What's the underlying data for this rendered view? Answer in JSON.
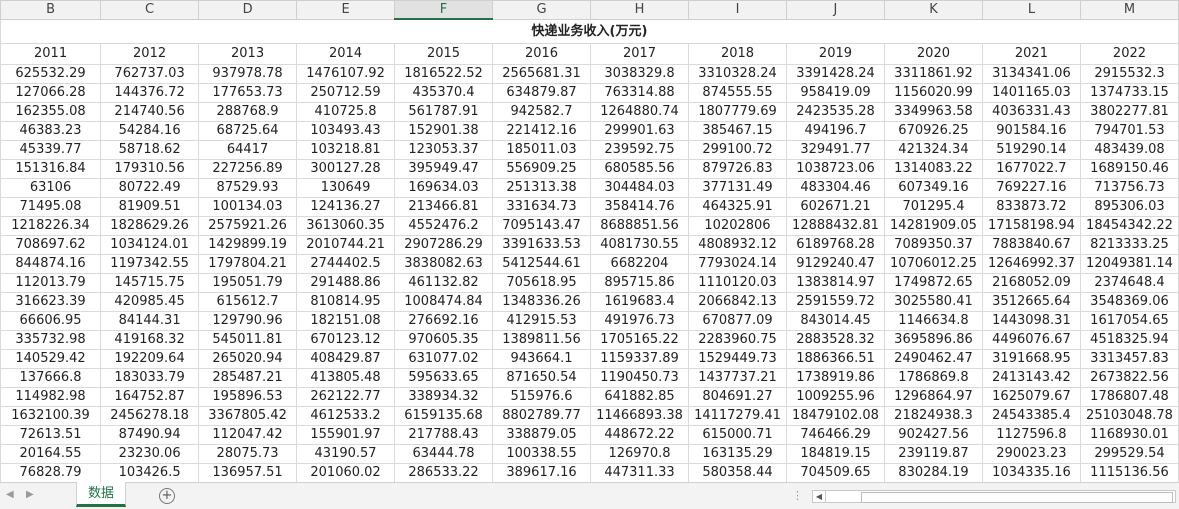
{
  "columns": [
    "B",
    "C",
    "D",
    "E",
    "F",
    "G",
    "H",
    "I",
    "J",
    "K",
    "L",
    "M"
  ],
  "selected_column": "F",
  "title": "快递业务收入(万元)",
  "years": [
    "2011",
    "2012",
    "2013",
    "2014",
    "2015",
    "2016",
    "2017",
    "2018",
    "2019",
    "2020",
    "2021",
    "2022"
  ],
  "rows": [
    [
      "625532.29",
      "762737.03",
      "937978.78",
      "1476107.92",
      "1816522.52",
      "2565681.31",
      "3038329.8",
      "3310328.24",
      "3391428.24",
      "3311861.92",
      "3134341.06",
      "2915532.3"
    ],
    [
      "127066.28",
      "144376.72",
      "177653.73",
      "250712.59",
      "435370.4",
      "634879.87",
      "763314.88",
      "874555.55",
      "958419.09",
      "1156020.99",
      "1401165.03",
      "1374733.15"
    ],
    [
      "162355.08",
      "214740.56",
      "288768.9",
      "410725.8",
      "561787.91",
      "942582.7",
      "1264880.74",
      "1807779.69",
      "2423535.28",
      "3349963.58",
      "4036331.43",
      "3802277.81"
    ],
    [
      "46383.23",
      "54284.16",
      "68725.64",
      "103493.43",
      "152901.38",
      "221412.16",
      "299901.63",
      "385467.15",
      "494196.7",
      "670926.25",
      "901584.16",
      "794701.53"
    ],
    [
      "45339.77",
      "58718.62",
      "64417",
      "103218.81",
      "123053.37",
      "185011.03",
      "239592.75",
      "299100.72",
      "329491.77",
      "421324.34",
      "519290.14",
      "483439.08"
    ],
    [
      "151316.84",
      "179310.56",
      "227256.89",
      "300127.28",
      "395949.47",
      "556909.25",
      "680585.56",
      "879726.83",
      "1038723.06",
      "1314083.22",
      "1677022.7",
      "1689150.46"
    ],
    [
      "63106",
      "80722.49",
      "87529.93",
      "130649",
      "169634.03",
      "251313.38",
      "304484.03",
      "377131.49",
      "483304.46",
      "607349.16",
      "769227.16",
      "713756.73"
    ],
    [
      "71495.08",
      "81909.51",
      "100134.03",
      "124136.27",
      "213466.81",
      "331634.73",
      "358414.76",
      "464325.91",
      "602671.21",
      "701295.4",
      "833873.72",
      "895306.03"
    ],
    [
      "1218226.34",
      "1828629.26",
      "2575921.26",
      "3613060.35",
      "4552476.2",
      "7095143.47",
      "8688851.56",
      "10202806",
      "12888432.81",
      "14281909.05",
      "17158198.94",
      "18454342.22"
    ],
    [
      "708697.62",
      "1034124.01",
      "1429899.19",
      "2010744.21",
      "2907286.29",
      "3391633.53",
      "4081730.55",
      "4808932.12",
      "6189768.28",
      "7089350.37",
      "7883840.67",
      "8213333.25"
    ],
    [
      "844874.16",
      "1197342.55",
      "1797804.21",
      "2744402.5",
      "3838082.63",
      "5412544.61",
      "6682204",
      "7793024.14",
      "9129240.47",
      "10706012.25",
      "12646992.37",
      "12049381.14"
    ],
    [
      "112013.79",
      "145715.75",
      "195051.79",
      "291488.86",
      "461132.82",
      "705618.95",
      "895715.86",
      "1110120.03",
      "1383814.97",
      "1749872.65",
      "2168052.09",
      "2374648.4"
    ],
    [
      "316623.39",
      "420985.45",
      "615612.7",
      "810814.95",
      "1008474.84",
      "1348336.26",
      "1619683.4",
      "2066842.13",
      "2591559.72",
      "3025580.41",
      "3512665.64",
      "3548369.06"
    ],
    [
      "66606.95",
      "84144.31",
      "129790.96",
      "182151.08",
      "276692.16",
      "412915.53",
      "491976.73",
      "670877.09",
      "843014.45",
      "1146634.8",
      "1443098.31",
      "1617054.65"
    ],
    [
      "335732.98",
      "419168.32",
      "545011.81",
      "670123.12",
      "970605.35",
      "1389811.56",
      "1705165.22",
      "2283960.75",
      "2883528.32",
      "3695896.86",
      "4496076.67",
      "4518325.94"
    ],
    [
      "140529.42",
      "192209.64",
      "265020.94",
      "408429.87",
      "631077.02",
      "943664.1",
      "1159337.89",
      "1529449.73",
      "1886366.51",
      "2490462.47",
      "3191668.95",
      "3313457.83"
    ],
    [
      "137666.8",
      "183033.79",
      "285487.21",
      "413805.48",
      "595633.65",
      "871650.54",
      "1190450.73",
      "1437737.21",
      "1738919.86",
      "1786869.8",
      "2413143.42",
      "2673822.56"
    ],
    [
      "114982.98",
      "164752.87",
      "195896.53",
      "262122.77",
      "338934.32",
      "515976.6",
      "641882.85",
      "804691.27",
      "1009255.96",
      "1296864.97",
      "1625079.67",
      "1786807.48"
    ],
    [
      "1632100.39",
      "2456278.18",
      "3367805.42",
      "4612533.2",
      "6159135.68",
      "8802789.77",
      "11466893.38",
      "14117279.41",
      "18479102.08",
      "21824938.3",
      "24543385.4",
      "25103048.78"
    ],
    [
      "72613.51",
      "87490.94",
      "112047.42",
      "155901.97",
      "217788.43",
      "338879.05",
      "448672.22",
      "615000.71",
      "746466.29",
      "902427.56",
      "1127596.8",
      "1168930.01"
    ],
    [
      "20164.55",
      "23230.06",
      "28075.73",
      "43190.57",
      "63444.78",
      "100338.55",
      "126970.8",
      "163135.29",
      "184819.15",
      "239119.87",
      "290023.23",
      "299529.54"
    ],
    [
      "76828.79",
      "103426.5",
      "136957.51",
      "201060.02",
      "286533.22",
      "389617.16",
      "447311.33",
      "580358.44",
      "704509.65",
      "830284.19",
      "1034335.16",
      "1115136.56"
    ]
  ],
  "sheet_tab": "数据",
  "add_sheet_label": "+",
  "nav": {
    "prev": "◀",
    "next": "▶",
    "first": "|◀"
  },
  "colors": {
    "accent": "#217346",
    "grid": "#dadada",
    "header_bg": "#f2f2f2"
  }
}
